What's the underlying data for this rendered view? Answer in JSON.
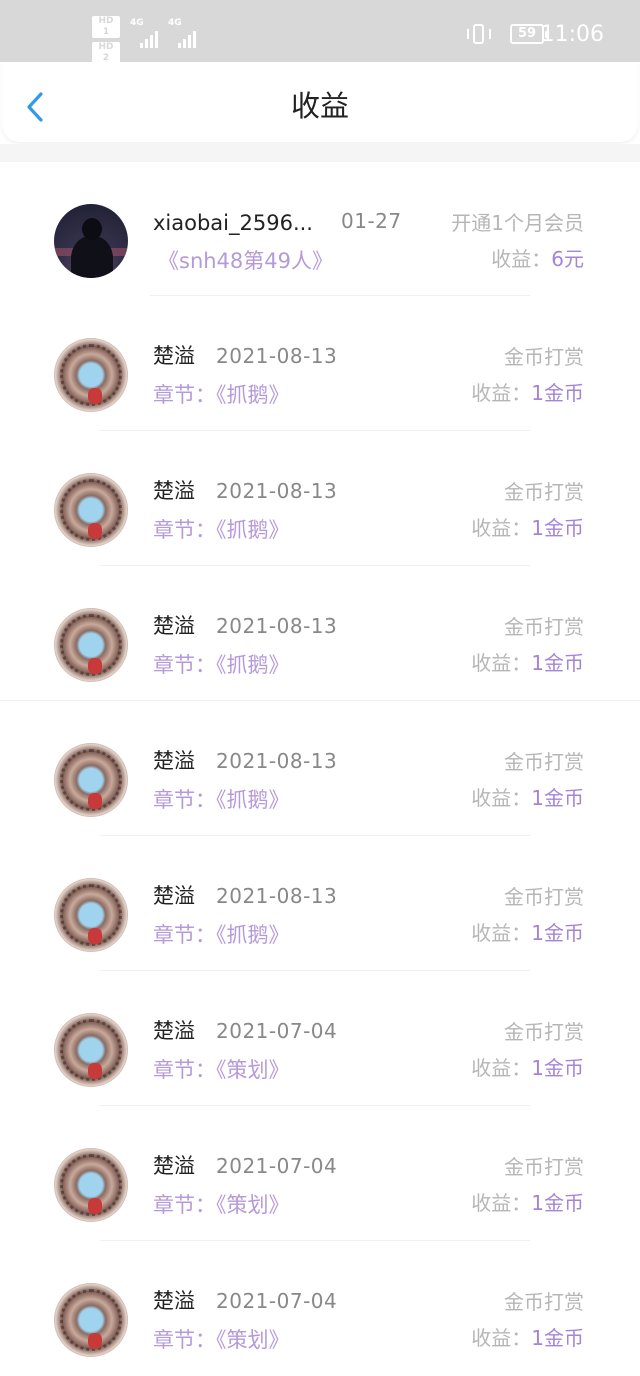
{
  "status_bar": {
    "sim1": "HD 1",
    "sim2": "HD 2",
    "network1": "4G",
    "network2": "4G",
    "battery": "59",
    "time": "11:06"
  },
  "header": {
    "back_icon": "chevron-left-icon",
    "title": "收益"
  },
  "records": [
    {
      "avatar": "dark-figure",
      "name": "xiaobai_2596...",
      "date": "01-27",
      "subtitle": "《snh48第49人》",
      "type": "开通1个月会员",
      "earn_label": "收益：",
      "earn_value": "6元"
    },
    {
      "avatar": "group-photo",
      "name": "楚溢",
      "date": "2021-08-13",
      "subtitle": "章节：《抓鹅》",
      "type": "金币打赏",
      "earn_label": "收益：",
      "earn_value": "1金币"
    },
    {
      "avatar": "group-photo",
      "name": "楚溢",
      "date": "2021-08-13",
      "subtitle": "章节：《抓鹅》",
      "type": "金币打赏",
      "earn_label": "收益：",
      "earn_value": "1金币"
    },
    {
      "avatar": "group-photo",
      "name": "楚溢",
      "date": "2021-08-13",
      "subtitle": "章节：《抓鹅》",
      "type": "金币打赏",
      "earn_label": "收益：",
      "earn_value": "1金币"
    },
    {
      "avatar": "group-photo",
      "name": "楚溢",
      "date": "2021-08-13",
      "subtitle": "章节：《抓鹅》",
      "type": "金币打赏",
      "earn_label": "收益：",
      "earn_value": "1金币"
    },
    {
      "avatar": "group-photo",
      "name": "楚溢",
      "date": "2021-08-13",
      "subtitle": "章节：《抓鹅》",
      "type": "金币打赏",
      "earn_label": "收益：",
      "earn_value": "1金币"
    },
    {
      "avatar": "group-photo",
      "name": "楚溢",
      "date": "2021-07-04",
      "subtitle": "章节：《策划》",
      "type": "金币打赏",
      "earn_label": "收益：",
      "earn_value": "1金币"
    },
    {
      "avatar": "group-photo",
      "name": "楚溢",
      "date": "2021-07-04",
      "subtitle": "章节：《策划》",
      "type": "金币打赏",
      "earn_label": "收益：",
      "earn_value": "1金币"
    },
    {
      "avatar": "group-photo",
      "name": "楚溢",
      "date": "2021-07-04",
      "subtitle": "章节：《策划》",
      "type": "金币打赏",
      "earn_label": "收益：",
      "earn_value": "1金币"
    }
  ],
  "colors": {
    "accent_purple": "#a584d6",
    "subtitle_purple": "#b59ad9",
    "back_blue": "#2f9be6",
    "status_bar_bg": "#d8d8d8"
  }
}
